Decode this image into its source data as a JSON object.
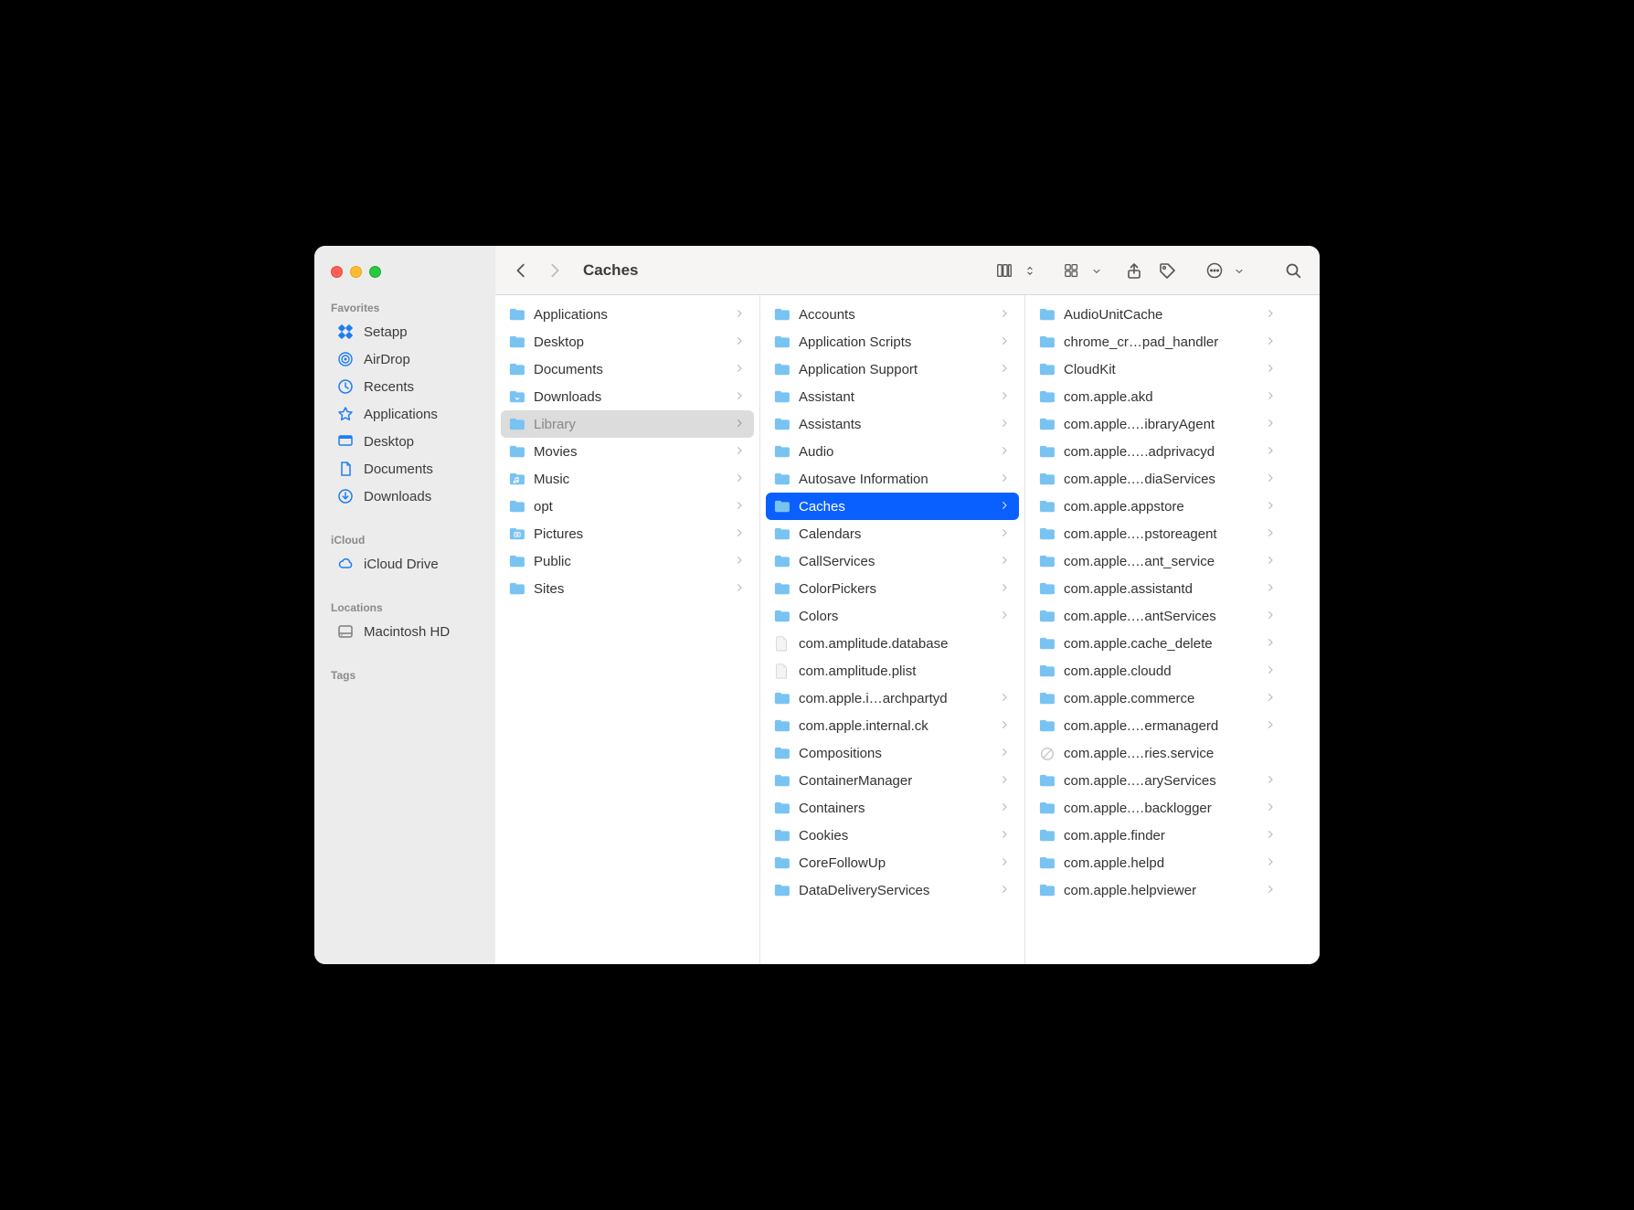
{
  "window": {
    "title": "Caches"
  },
  "sidebar": {
    "sections": [
      {
        "header": "Favorites",
        "items": [
          {
            "icon": "setapp",
            "label": "Setapp"
          },
          {
            "icon": "airdrop",
            "label": "AirDrop"
          },
          {
            "icon": "clock",
            "label": "Recents"
          },
          {
            "icon": "apps",
            "label": "Applications"
          },
          {
            "icon": "desktop",
            "label": "Desktop"
          },
          {
            "icon": "document",
            "label": "Documents"
          },
          {
            "icon": "download",
            "label": "Downloads"
          }
        ]
      },
      {
        "header": "iCloud",
        "items": [
          {
            "icon": "cloud",
            "label": "iCloud Drive"
          }
        ]
      },
      {
        "header": "Locations",
        "items": [
          {
            "icon": "disk",
            "label": "Macintosh HD"
          }
        ]
      },
      {
        "header": "Tags",
        "items": []
      }
    ]
  },
  "columns": [
    {
      "items": [
        {
          "type": "folder",
          "name": "Applications",
          "hasChildren": true
        },
        {
          "type": "folder",
          "name": "Desktop",
          "hasChildren": true
        },
        {
          "type": "folder",
          "name": "Documents",
          "hasChildren": true
        },
        {
          "type": "folder-dl",
          "name": "Downloads",
          "hasChildren": true
        },
        {
          "type": "folder",
          "name": "Library",
          "hasChildren": true,
          "selected": "path"
        },
        {
          "type": "folder",
          "name": "Movies",
          "hasChildren": true
        },
        {
          "type": "folder-music",
          "name": "Music",
          "hasChildren": true
        },
        {
          "type": "folder",
          "name": "opt",
          "hasChildren": true
        },
        {
          "type": "folder-pics",
          "name": "Pictures",
          "hasChildren": true
        },
        {
          "type": "folder",
          "name": "Public",
          "hasChildren": true
        },
        {
          "type": "folder",
          "name": "Sites",
          "hasChildren": true
        }
      ]
    },
    {
      "items": [
        {
          "type": "folder",
          "name": "Accounts",
          "hasChildren": true
        },
        {
          "type": "folder",
          "name": "Application Scripts",
          "hasChildren": true
        },
        {
          "type": "folder",
          "name": "Application Support",
          "hasChildren": true
        },
        {
          "type": "folder",
          "name": "Assistant",
          "hasChildren": true
        },
        {
          "type": "folder",
          "name": "Assistants",
          "hasChildren": true
        },
        {
          "type": "folder",
          "name": "Audio",
          "hasChildren": true
        },
        {
          "type": "folder",
          "name": "Autosave Information",
          "hasChildren": true
        },
        {
          "type": "folder",
          "name": "Caches",
          "hasChildren": true,
          "selected": "active"
        },
        {
          "type": "folder",
          "name": "Calendars",
          "hasChildren": true
        },
        {
          "type": "folder",
          "name": "CallServices",
          "hasChildren": true
        },
        {
          "type": "folder",
          "name": "ColorPickers",
          "hasChildren": true
        },
        {
          "type": "folder",
          "name": "Colors",
          "hasChildren": true
        },
        {
          "type": "file",
          "name": "com.amplitude.database",
          "hasChildren": false
        },
        {
          "type": "file",
          "name": "com.amplitude.plist",
          "hasChildren": false
        },
        {
          "type": "folder",
          "name": "com.apple.i…archpartyd",
          "hasChildren": true
        },
        {
          "type": "folder",
          "name": "com.apple.internal.ck",
          "hasChildren": true
        },
        {
          "type": "folder",
          "name": "Compositions",
          "hasChildren": true
        },
        {
          "type": "folder",
          "name": "ContainerManager",
          "hasChildren": true
        },
        {
          "type": "folder",
          "name": "Containers",
          "hasChildren": true
        },
        {
          "type": "folder",
          "name": "Cookies",
          "hasChildren": true
        },
        {
          "type": "folder",
          "name": "CoreFollowUp",
          "hasChildren": true
        },
        {
          "type": "folder",
          "name": "DataDeliveryServices",
          "hasChildren": true
        }
      ]
    },
    {
      "items": [
        {
          "type": "folder",
          "name": "AudioUnitCache",
          "hasChildren": true
        },
        {
          "type": "folder",
          "name": "chrome_cr…pad_handler",
          "hasChildren": true
        },
        {
          "type": "folder",
          "name": "CloudKit",
          "hasChildren": true
        },
        {
          "type": "folder",
          "name": "com.apple.akd",
          "hasChildren": true
        },
        {
          "type": "folder",
          "name": "com.apple.…ibraryAgent",
          "hasChildren": true
        },
        {
          "type": "folder",
          "name": "com.apple.….adprivacyd",
          "hasChildren": true
        },
        {
          "type": "folder",
          "name": "com.apple.…diaServices",
          "hasChildren": true
        },
        {
          "type": "folder",
          "name": "com.apple.appstore",
          "hasChildren": true
        },
        {
          "type": "folder",
          "name": "com.apple.…pstoreagent",
          "hasChildren": true
        },
        {
          "type": "folder",
          "name": "com.apple.…ant_service",
          "hasChildren": true
        },
        {
          "type": "folder",
          "name": "com.apple.assistantd",
          "hasChildren": true
        },
        {
          "type": "folder",
          "name": "com.apple.…antServices",
          "hasChildren": true
        },
        {
          "type": "folder",
          "name": "com.apple.cache_delete",
          "hasChildren": true
        },
        {
          "type": "folder",
          "name": "com.apple.cloudd",
          "hasChildren": true
        },
        {
          "type": "folder",
          "name": "com.apple.commerce",
          "hasChildren": true
        },
        {
          "type": "folder",
          "name": "com.apple.…ermanagerd",
          "hasChildren": true
        },
        {
          "type": "blocked",
          "name": "com.apple.…ries.service",
          "hasChildren": false
        },
        {
          "type": "folder",
          "name": "com.apple.…aryServices",
          "hasChildren": true
        },
        {
          "type": "folder",
          "name": "com.apple.…backlogger",
          "hasChildren": true
        },
        {
          "type": "folder",
          "name": "com.apple.finder",
          "hasChildren": true
        },
        {
          "type": "folder",
          "name": "com.apple.helpd",
          "hasChildren": true
        },
        {
          "type": "folder",
          "name": "com.apple.helpviewer",
          "hasChildren": true
        }
      ]
    }
  ]
}
